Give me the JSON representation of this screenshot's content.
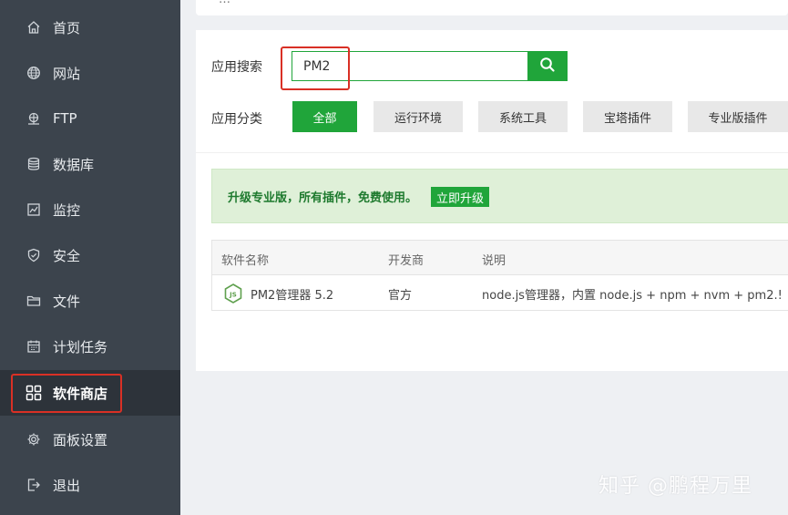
{
  "sidebar": {
    "items": [
      {
        "label": "首页",
        "icon": "home-icon"
      },
      {
        "label": "网站",
        "icon": "globe-icon"
      },
      {
        "label": "FTP",
        "icon": "ftp-icon"
      },
      {
        "label": "数据库",
        "icon": "database-icon"
      },
      {
        "label": "监控",
        "icon": "monitor-icon"
      },
      {
        "label": "安全",
        "icon": "shield-icon"
      },
      {
        "label": "文件",
        "icon": "folder-icon"
      },
      {
        "label": "计划任务",
        "icon": "calendar-icon"
      },
      {
        "label": "软件商店",
        "icon": "grid-icon"
      },
      {
        "label": "面板设置",
        "icon": "gear-icon"
      },
      {
        "label": "退出",
        "icon": "logout-icon"
      }
    ],
    "active_label": "软件商店"
  },
  "top_card": {
    "cut_text": "…"
  },
  "search": {
    "label": "应用搜索",
    "value": "PM2"
  },
  "category": {
    "label": "应用分类",
    "buttons": [
      "全部",
      "运行环境",
      "系统工具",
      "宝塔插件",
      "专业版插件"
    ],
    "active": "全部"
  },
  "promo": {
    "text": "升级专业版，所有插件，免费使用。",
    "button": "立即升级"
  },
  "table": {
    "headers": [
      "软件名称",
      "开发商",
      "说明"
    ],
    "rows": [
      {
        "name": "PM2管理器 5.2",
        "developer": "官方",
        "description": "node.js管理器，内置 node.js + npm + nvm + pm2.!"
      }
    ]
  },
  "watermark": "知乎 @鹏程万里",
  "colors": {
    "sidebar_bg": "#3c444d",
    "sidebar_active_bg": "#2d333a",
    "accent_green": "#20a53a",
    "highlight_red": "#d93025",
    "promo_bg": "#dff0d8"
  }
}
